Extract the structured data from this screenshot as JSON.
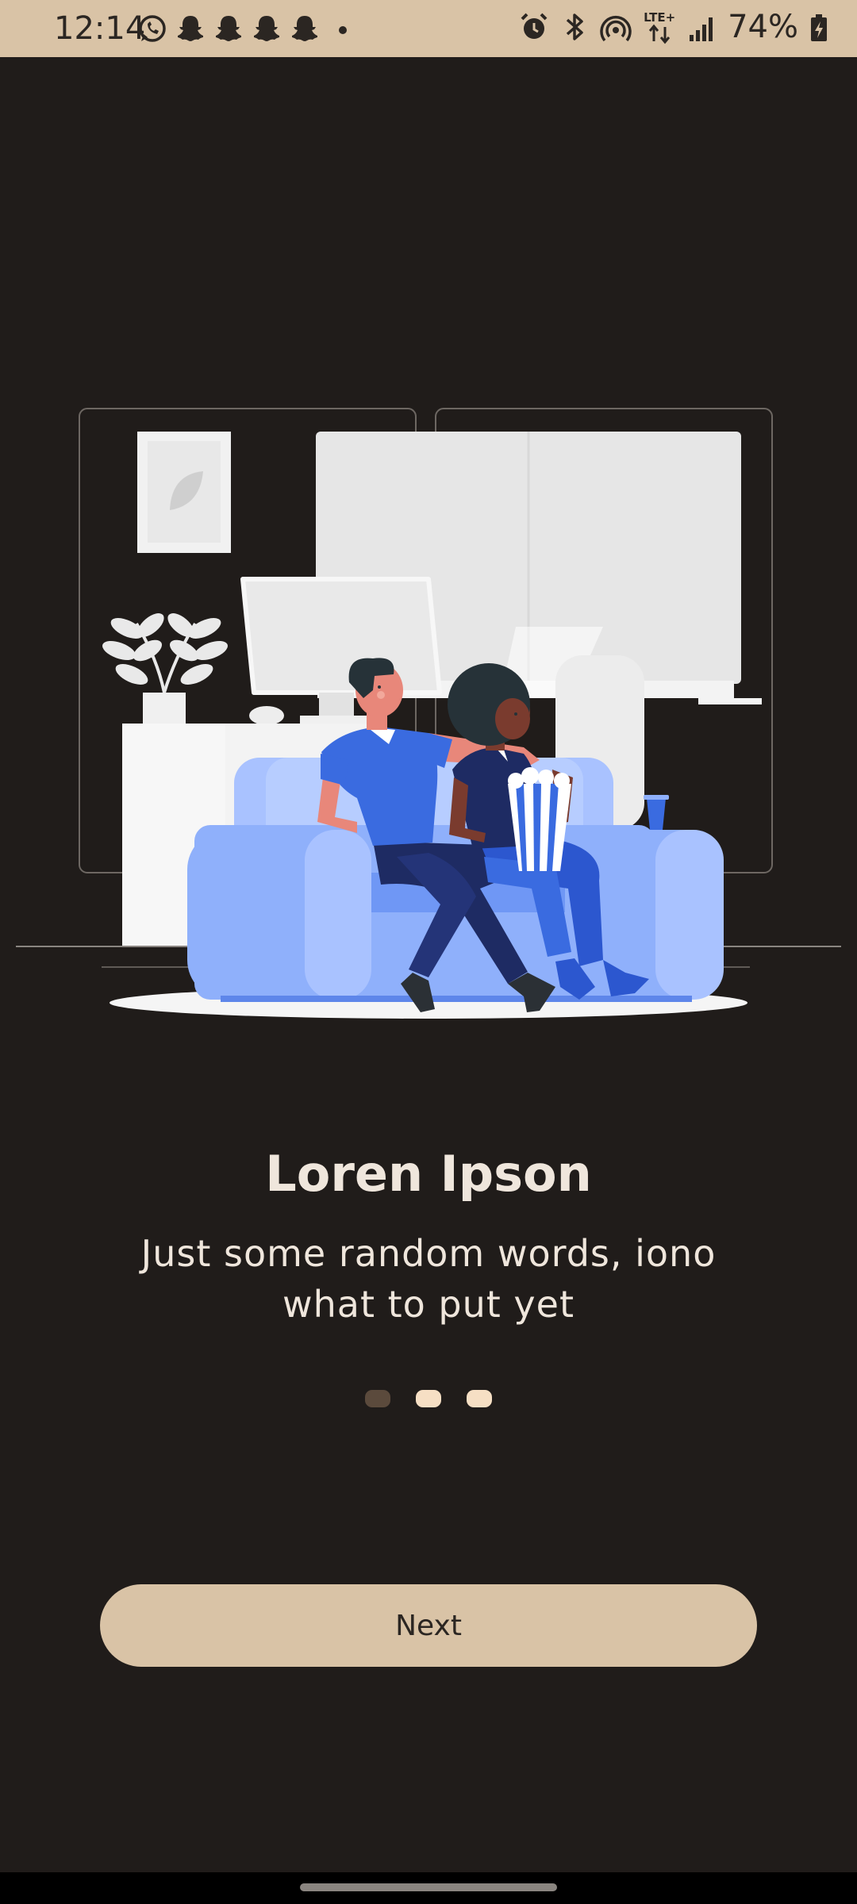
{
  "status_bar": {
    "time": "12:14",
    "battery": "74%",
    "left_icons": [
      "whatsapp-icon",
      "snapchat-icon",
      "snapchat-icon",
      "snapchat-icon",
      "snapchat-icon",
      "dot-icon"
    ],
    "right_icons": [
      "alarm-icon",
      "bluetooth-icon",
      "hotspot-icon",
      "lte-icon",
      "signal-icon",
      "battery-charging-icon"
    ],
    "lte_label": "LTE+"
  },
  "onboarding": {
    "title": "Loren Ipson",
    "subtitle": "Just some random words, iono what to put yet",
    "page_count": 3,
    "active_page": 1,
    "next_label": "Next"
  },
  "colors": {
    "background": "#201c1a",
    "accent": "#d9c3a6",
    "text": "#efe6dc",
    "dot": "#f6dfc4",
    "dot_active": "#5b4a3c",
    "sofa": "#8fb0fb",
    "shirt": "#3a6be0"
  }
}
